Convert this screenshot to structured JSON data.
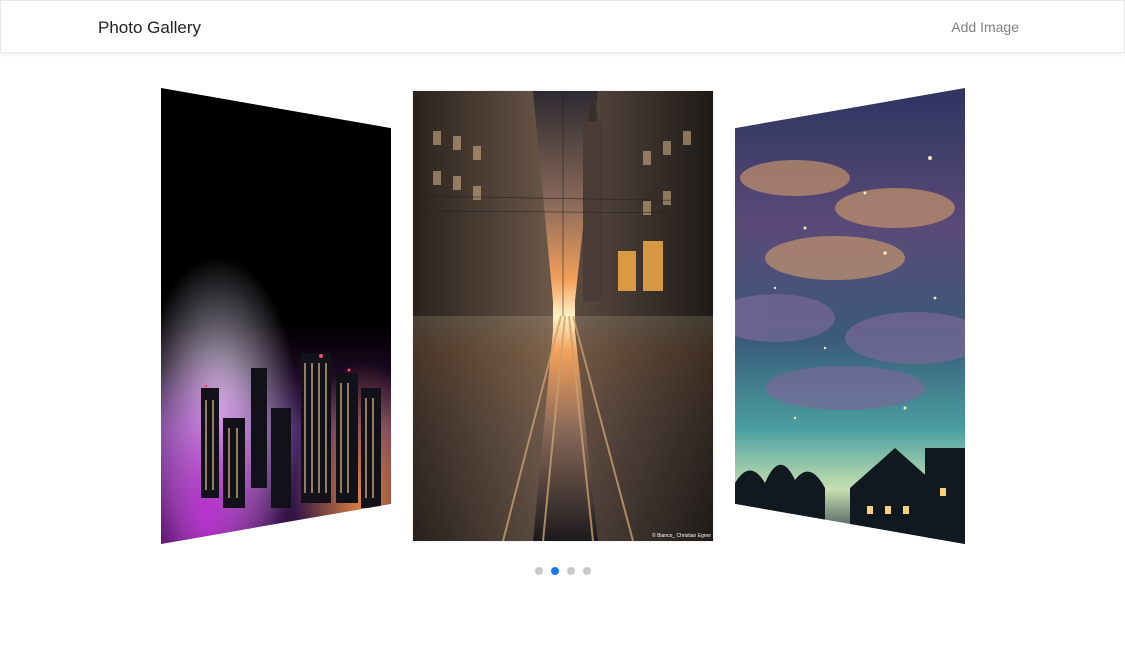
{
  "app": {
    "title": "Photo Gallery",
    "add_button_label": "Add Image"
  },
  "gallery": {
    "slides": [
      {
        "name": "foggy-city-night",
        "position": "left"
      },
      {
        "name": "city-street-reflection",
        "position": "center",
        "credit": "© Bianco_ Christian Egner"
      },
      {
        "name": "starry-sky-painting",
        "position": "right"
      }
    ],
    "pagination": {
      "count": 4,
      "active_index": 1
    }
  },
  "colors": {
    "accent": "#1677ff",
    "dot_inactive": "#c9c9c9",
    "header_text": "#222222",
    "add_button_text": "#808080"
  }
}
